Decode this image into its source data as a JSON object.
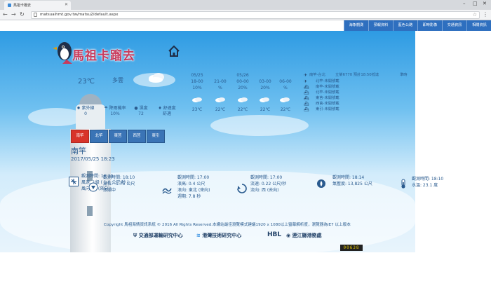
{
  "browser": {
    "tab_title": "馬祖卡蹓去",
    "url": "matsuaihmt.gov.tw/matsu2/default.aspx"
  },
  "topnav": [
    "海象觀測",
    "預報資料",
    "藍色公路",
    "即時影像",
    "交通資訊",
    "相關資訊"
  ],
  "site": {
    "title": "馬祖卡蹓去",
    "home_icon": "house-icon"
  },
  "weather": {
    "temp": "23℃",
    "condition": "多雲",
    "forecast": [
      {
        "date": "05/25",
        "time": "18-00",
        "pop": "10%",
        "temp": "23℃"
      },
      {
        "date": "",
        "time": "21-00",
        "pop": "%",
        "temp": "22℃"
      },
      {
        "date": "05/26",
        "time": "00-00",
        "pop": "20%",
        "temp": "22℃"
      },
      {
        "date": "",
        "time": "03-00",
        "pop": "20%",
        "temp": "22℃"
      },
      {
        "date": "",
        "time": "06-00",
        "pop": "%",
        "temp": "22℃"
      }
    ],
    "stats": [
      {
        "label": "紫外線",
        "value": "0"
      },
      {
        "label": "降雨機率",
        "value": "10%"
      },
      {
        "label": "濕度",
        "value": "72"
      },
      {
        "label": "舒適度",
        "value": "舒適"
      }
    ]
  },
  "routes": {
    "header": "南竿-台北",
    "line1": "立榮6770 預計18:50抵達",
    "line1_status": "準時",
    "items": [
      "北竿-未開號載",
      "南竿-未開號載",
      "北竿-未開號載",
      "東莒-未開號載",
      "西莒-未開號載",
      "東引-未開號載"
    ]
  },
  "areas": {
    "buttons": [
      "南竿",
      "北竿",
      "東莒",
      "西莒",
      "東引"
    ],
    "selected": "南竿",
    "location": "南竿",
    "datetime": "2017/05/25 18:23"
  },
  "observations": [
    {
      "icon": "wind-icon",
      "lines": [
        "觀測時間: 16:20",
        "風速: 1級 ( 1.0 公尺/秒 )",
        "風向: 北 (來向)"
      ]
    },
    {
      "icon": "tide-icon",
      "lines": [
        "觀測時間: 18:10",
        "潮位: -1.75 公尺",
        "漲潮中"
      ]
    },
    {
      "icon": "wave-icon",
      "lines": [
        "觀測時間: 17:00",
        "浪高: 0.4 公尺",
        "浪向: 東北 (來向)",
        "週期: 7.8 秒"
      ]
    },
    {
      "icon": "current-icon",
      "lines": [
        "觀測時間: 17:00",
        "流速: 0.22 公尺/秒",
        "流向: 西 (去向)"
      ]
    },
    {
      "icon": "pressure-icon",
      "lines": [
        "觀測時間: 18:14",
        "氣壓度: 13,825 公尺"
      ]
    },
    {
      "icon": "thermometer-icon",
      "lines": [
        "觀測時間: 18:10",
        "水溫: 23.1 度"
      ]
    }
  ],
  "footer": {
    "copyright": "Copyright 馬祖海情資訊系統 © 2016 All Rights Reserved.本網站最佳瀏覽模式建議1920 x 1080以上螢幕解析度，瀏覽器為IE7 以上版本",
    "logos": [
      "交通部運輸研究中心",
      "港灣技術研究中心",
      "HBL",
      "連江縣港務處"
    ],
    "counter": "00638"
  }
}
